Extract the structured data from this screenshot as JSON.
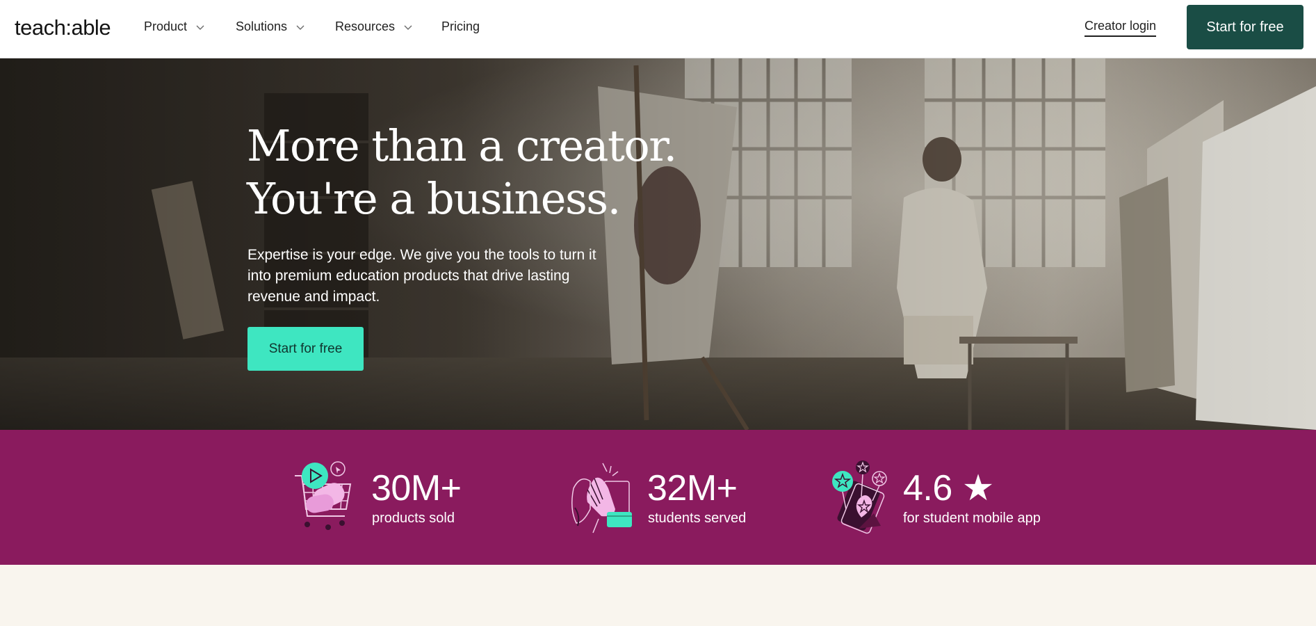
{
  "nav": {
    "logo": "teach:able",
    "items": [
      {
        "label": "Product",
        "has_dropdown": true
      },
      {
        "label": "Solutions",
        "has_dropdown": true
      },
      {
        "label": "Resources",
        "has_dropdown": true
      },
      {
        "label": "Pricing",
        "has_dropdown": false
      }
    ],
    "creator_login": "Creator login",
    "cta": "Start for free"
  },
  "hero": {
    "title_line1": "More than a creator.",
    "title_line2": "You're a business.",
    "subtitle": "Expertise is your edge. We give you the tools to turn it into premium education products that drive lasting revenue and impact.",
    "cta": "Start for free"
  },
  "stats": [
    {
      "value": "30M+",
      "label": "products sold",
      "icon": "shopping-cart-icon"
    },
    {
      "value": "32M+",
      "label": "students served",
      "icon": "high-five-icon"
    },
    {
      "value": "4.6 ★",
      "label": "for student mobile app",
      "icon": "phone-stars-icon"
    }
  ],
  "colors": {
    "nav_cta_bg": "#1a4d45",
    "hero_cta_bg": "#3ee6c1",
    "stats_bg": "#8a1b5e",
    "page_bg": "#f9f5ee"
  }
}
